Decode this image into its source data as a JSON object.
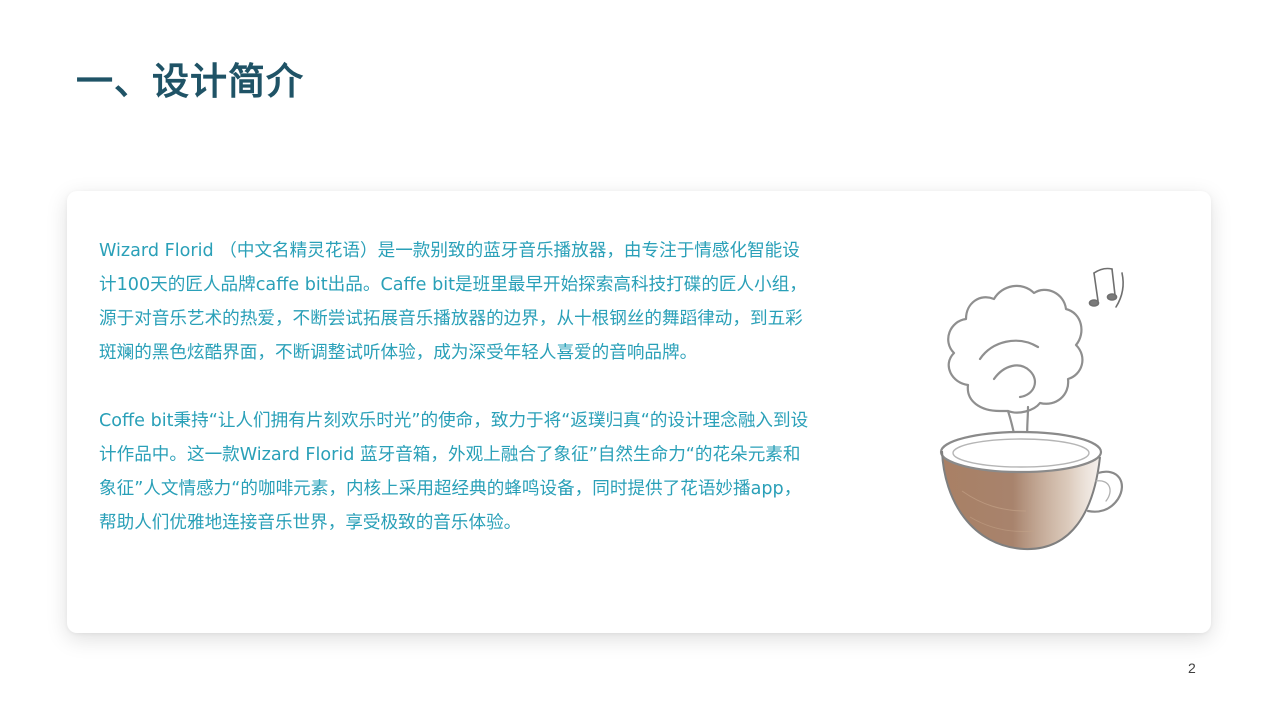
{
  "slide": {
    "title": "一、设计简介",
    "page_number": "2"
  },
  "content": {
    "paragraphs": [
      "Wizard Florid （中文名精灵花语）是一款别致的蓝牙音乐播放器，由专注于情感化智能设计100天的匠人品牌caffe bit出品。Caffe bit是班里最早开始探索高科技打碟的匠人小组，源于对音乐艺术的热爱，不断尝试拓展音乐播放器的边界，从十根钢丝的舞蹈律动，到五彩斑斓的黑色炫酷界面，不断调整试听体验，成为深受年轻人喜爱的音响品牌。",
      "Coffe bit秉持“让人们拥有片刻欢乐时光”的使命，致力于将“返璞归真“的设计理念融入到设计作品中。这一款Wizard Florid 蓝牙音箱，外观上融合了象征”自然生命力“的花朵元素和象征”人文情感力“的咖啡元素，内核上采用超经典的蜂鸣设备，同时提供了花语妙播app，帮助人们优雅地连接音乐世界，享受极致的音乐体验。"
    ]
  },
  "colors": {
    "title": "#1f5366",
    "body_text": "#2aa0b8",
    "cup_brown": "#8b5a3c"
  },
  "illustration": {
    "icon": "coffee-cup-flower-speaker-icon"
  }
}
